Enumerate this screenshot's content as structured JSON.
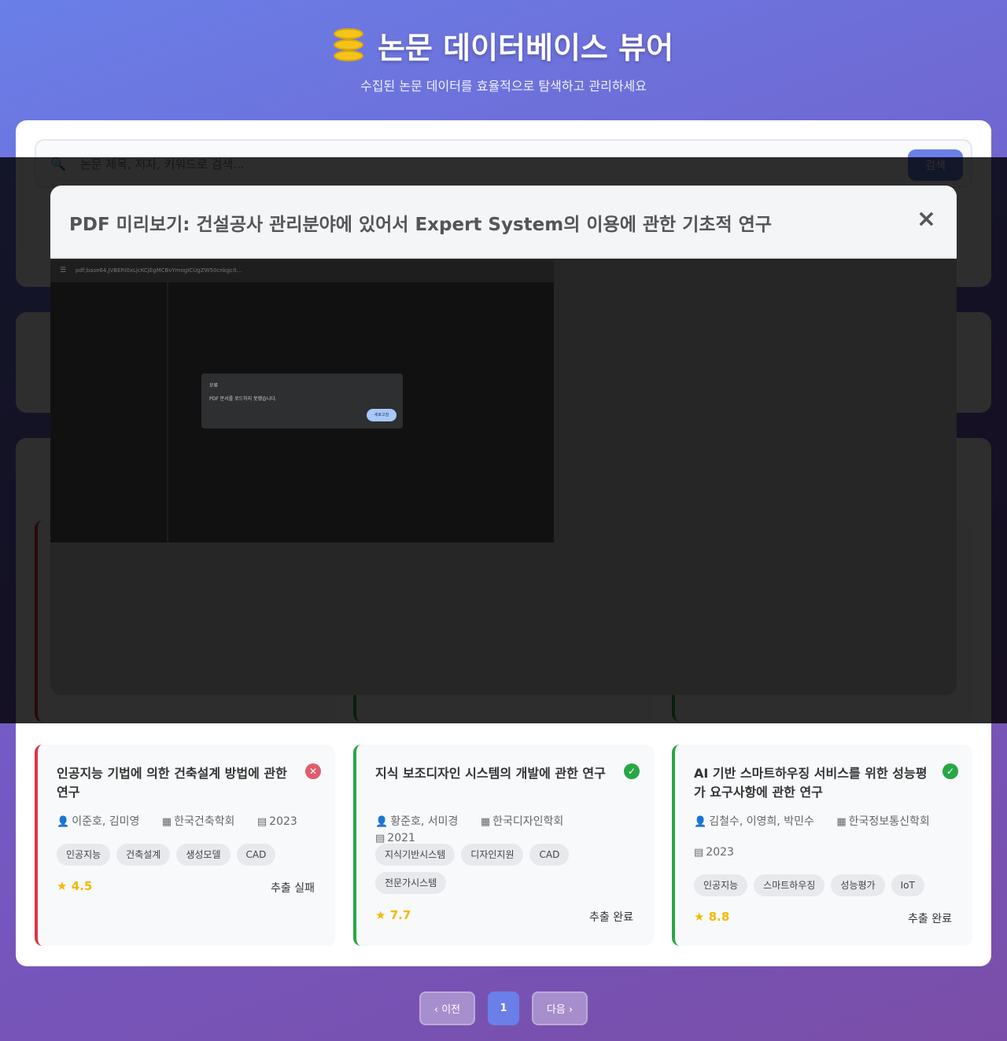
{
  "header": {
    "title": "논문 데이터베이스 뷰어",
    "subtitle": "수집된 논문 데이터를 효율적으로 탐색하고 관리하세요",
    "icon": "database-icon"
  },
  "search": {
    "placeholder": "논문 제목, 저자, 키워드로 검색...",
    "button_label": "검색"
  },
  "papers": [
    {
      "title": "인공지능 기법에 의한 건축설계 방법에 관한 연구",
      "authors": "이준호, 김미영",
      "publisher": "한국건축학회",
      "year": "2023",
      "tags": [
        "인공지능",
        "건축설계",
        "생성모델",
        "CAD"
      ],
      "rating": "4.5",
      "status": "추출 실패",
      "status_icon": "x-circle-icon",
      "status_color": "#e05c6b"
    },
    {
      "title": "지식 보조디자인 시스템의 개발에 관한 연구",
      "authors": "황준호, 서미경",
      "publisher": "한국디자인학회",
      "year": "2021",
      "tags": [
        "지식기반시스템",
        "디자인지원",
        "CAD",
        "전문가시스템"
      ],
      "rating": "7.7",
      "status": "추출 완료",
      "status_icon": "check-circle-icon",
      "status_color": "#28a745"
    },
    {
      "title": "AI 기반 스마트하우징 서비스를 위한 성능평가 요구사항에 관한 연구",
      "authors": "김철수, 이영희, 박민수",
      "publisher": "한국정보통신학회",
      "year": "2023",
      "tags": [
        "인공지능",
        "스마트하우징",
        "성능평가",
        "IoT"
      ],
      "rating": "8.8",
      "status": "추출 완료",
      "status_icon": "check-circle-icon",
      "status_color": "#28a745"
    }
  ],
  "modal": {
    "title": "PDF 미리보기: 건설공사 관리분야에 있어서 Expert System의 이용에 관한 기초적 연구",
    "close_label": "×",
    "pdf_url": "pdf;base64,JVBERi0xLjcKCjEgMCBvYmogICUgZW50cnkgc0...",
    "error_title": "오류",
    "error_message": "PDF 문서를 로드하지 못했습니다.",
    "reload_label": "새로고침"
  },
  "pagination": {
    "prev_label": "‹ 이전",
    "current_page": "1",
    "next_label": "다음 ›"
  },
  "colors": {
    "accent": "#6a7fe8",
    "fail": "#e05c6b",
    "success": "#28a745",
    "rating": "#f5b800"
  }
}
